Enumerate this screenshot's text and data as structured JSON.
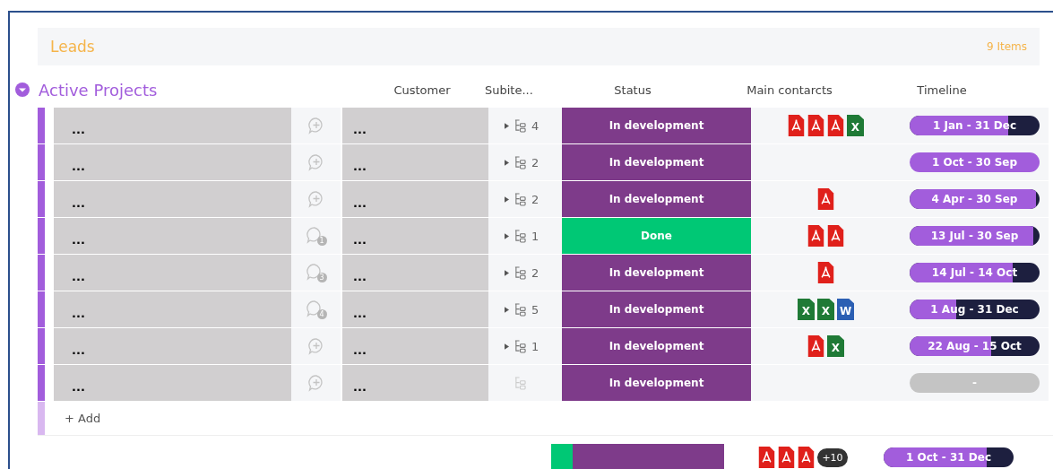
{
  "leads": {
    "title": "Leads",
    "count": "9 Items"
  },
  "group": {
    "title": "Active Projects",
    "expanded": true,
    "columns": [
      "Customer",
      "Subite...",
      "Status",
      "Main contarcts",
      "Timeline"
    ],
    "rows": [
      {
        "name": "...",
        "comment": {
          "kind": "add"
        },
        "customer": "...",
        "subitems": {
          "expandable": true,
          "count": "4"
        },
        "status": {
          "label": "In development",
          "color": "#7e3b8a"
        },
        "contacts": [
          {
            "kind": "pdf"
          },
          {
            "kind": "pdf"
          },
          {
            "kind": "pdf"
          },
          {
            "kind": "xls",
            "label": "X"
          }
        ],
        "timeline": {
          "kind": "range",
          "label": "1 Jan - 31 Dec",
          "level": 0.76
        }
      },
      {
        "name": "...",
        "comment": {
          "kind": "add"
        },
        "customer": "...",
        "subitems": {
          "expandable": true,
          "count": "2"
        },
        "status": {
          "label": "In development",
          "color": "#7e3b8a"
        },
        "contacts": [],
        "timeline": {
          "kind": "range",
          "label": "1 Oct - 30 Sep",
          "level": 1
        }
      },
      {
        "name": "...",
        "comment": {
          "kind": "add"
        },
        "customer": "...",
        "subitems": {
          "expandable": true,
          "count": "2"
        },
        "status": {
          "label": "In development",
          "color": "#7e3b8a"
        },
        "contacts": [
          {
            "kind": "pdf"
          }
        ],
        "timeline": {
          "kind": "range",
          "label": "4 Apr - 30 Sep",
          "level": 0.97
        }
      },
      {
        "name": "...",
        "comment": {
          "kind": "count",
          "count": "1"
        },
        "customer": "...",
        "subitems": {
          "expandable": true,
          "count": "1"
        },
        "status": {
          "label": "Done",
          "color": "#00c875"
        },
        "contacts": [
          {
            "kind": "pdf"
          },
          {
            "kind": "pdf"
          }
        ],
        "timeline": {
          "kind": "range",
          "label": "13 Jul - 30 Sep",
          "level": 0.95
        }
      },
      {
        "name": "...",
        "comment": {
          "kind": "count",
          "count": "3"
        },
        "customer": "...",
        "subitems": {
          "expandable": true,
          "count": "2"
        },
        "status": {
          "label": "In development",
          "color": "#7e3b8a"
        },
        "contacts": [
          {
            "kind": "pdf"
          }
        ],
        "timeline": {
          "kind": "range",
          "label": "14 Jul - 14 Oct",
          "level": 0.79
        }
      },
      {
        "name": "...",
        "comment": {
          "kind": "count",
          "count": "4"
        },
        "customer": "...",
        "subitems": {
          "expandable": true,
          "count": "5"
        },
        "status": {
          "label": "In development",
          "color": "#7e3b8a"
        },
        "contacts": [
          {
            "kind": "xls",
            "label": "X"
          },
          {
            "kind": "xls",
            "label": "X"
          },
          {
            "kind": "doc",
            "label": "W"
          }
        ],
        "timeline": {
          "kind": "range",
          "label": "1 Aug - 31 Dec",
          "level": 0.36
        }
      },
      {
        "name": "...",
        "comment": {
          "kind": "add"
        },
        "customer": "...",
        "subitems": {
          "expandable": true,
          "count": "1"
        },
        "status": {
          "label": "In development",
          "color": "#7e3b8a"
        },
        "contacts": [
          {
            "kind": "pdf"
          },
          {
            "kind": "xls",
            "label": "X"
          }
        ],
        "timeline": {
          "kind": "range",
          "label": "22 Aug - 15 Oct",
          "level": 0.63
        }
      },
      {
        "name": "...",
        "comment": {
          "kind": "add"
        },
        "customer": "...",
        "subitems": {
          "expandable": false
        },
        "status": {
          "label": "In development",
          "color": "#7e3b8a"
        },
        "contacts": [],
        "timeline": {
          "kind": "empty",
          "label": "-"
        }
      }
    ],
    "add_label": "+ Add",
    "summary": {
      "status": [
        {
          "color": "#00c875",
          "level": 0.125
        },
        {
          "color": "#7e3b8a",
          "level": 0.875
        }
      ],
      "contacts": [
        {
          "kind": "pdf"
        },
        {
          "kind": "pdf"
        },
        {
          "kind": "pdf"
        }
      ],
      "more": "+10",
      "timeline": {
        "label": "1 Oct - 31 Dec",
        "level": 0.79
      }
    }
  }
}
